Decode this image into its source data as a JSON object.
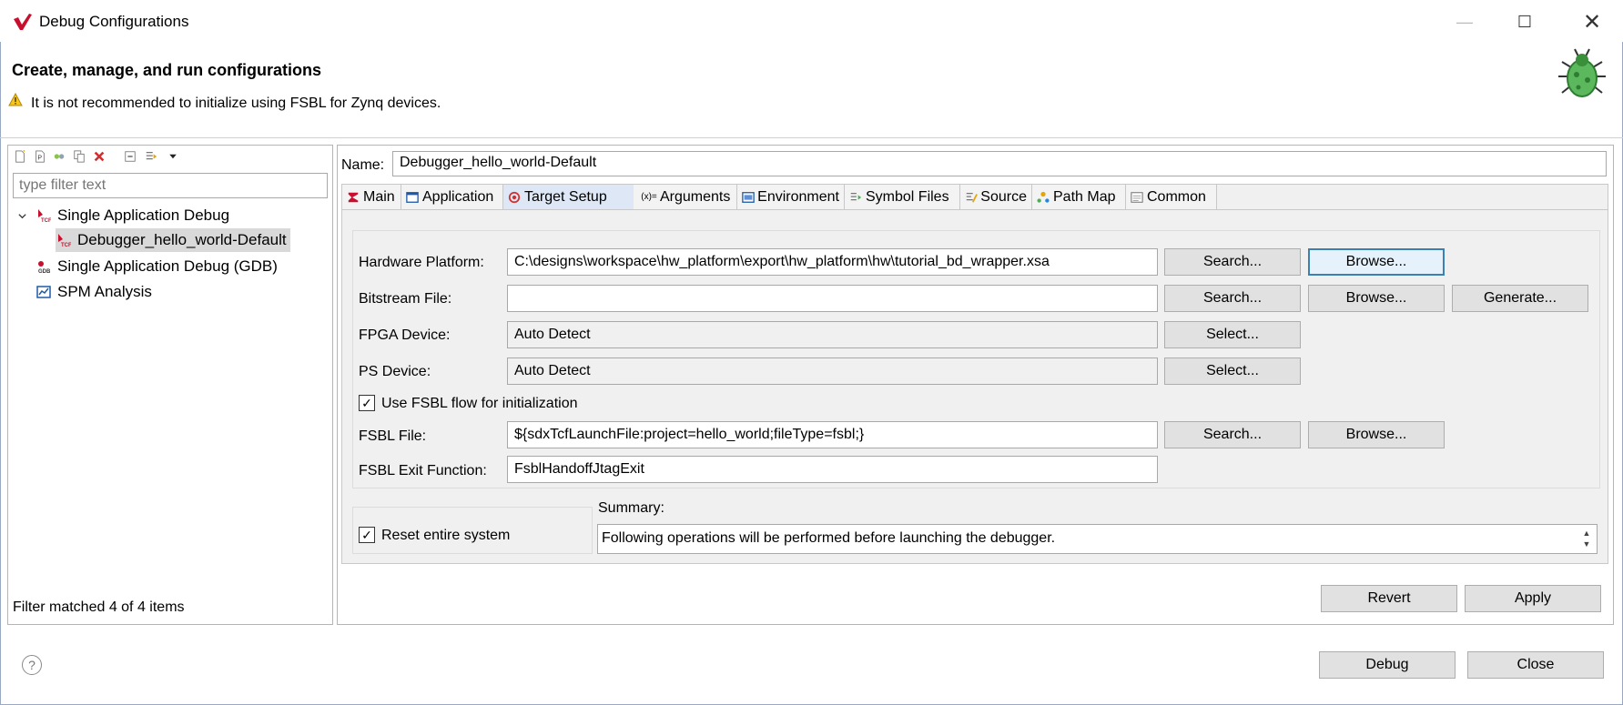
{
  "window": {
    "title": "Debug Configurations",
    "minimize": "—",
    "maximize": "☐",
    "close": "✕"
  },
  "header": {
    "title": "Create, manage, and run configurations",
    "message": "It is not recommended to initialize using FSBL for Zynq devices."
  },
  "left_panel": {
    "filter_placeholder": "type filter text",
    "toolbar_icons": [
      "new-config-icon",
      "new-prototype-icon",
      "export-icon",
      "duplicate-icon",
      "delete-icon",
      "collapse-all-icon",
      "filter-icon",
      "view-menu-icon"
    ],
    "tree": {
      "group1": "Single Application Debug",
      "child1": "Debugger_hello_world-Default",
      "group2": "Single Application Debug (GDB)",
      "group3": "SPM Analysis"
    },
    "status": "Filter matched 4 of 4 items"
  },
  "config": {
    "name_label": "Name:",
    "name_value": "Debugger_hello_world-Default",
    "tabs": {
      "main": "Main",
      "application": "Application",
      "target_setup": "Target Setup",
      "arguments": "Arguments",
      "environment": "Environment",
      "symbol_files": "Symbol Files",
      "source": "Source",
      "path_map": "Path Map",
      "common": "Common"
    },
    "active_tab": "Target Setup",
    "target_setup": {
      "hw_platform_label": "Hardware Platform:",
      "hw_platform_value": "C:\\designs\\workspace\\hw_platform\\export\\hw_platform\\hw\\tutorial_bd_wrapper.xsa",
      "bitstream_label": "Bitstream File:",
      "bitstream_value": "",
      "fpga_label": "FPGA Device:",
      "fpga_value": "Auto Detect",
      "ps_label": "PS Device:",
      "ps_value": "Auto Detect",
      "use_fsbl_label": "Use FSBL flow for initialization",
      "use_fsbl_checked": true,
      "fsbl_file_label": "FSBL File:",
      "fsbl_file_value": "${sdxTcfLaunchFile:project=hello_world;fileType=fsbl;}",
      "fsbl_exit_label": "FSBL Exit Function:",
      "fsbl_exit_value": "FsblHandoffJtagExit",
      "reset_label": "Reset entire system",
      "reset_checked": true,
      "summary_label": "Summary:",
      "summary_text": "Following operations will be performed before launching the debugger.",
      "search": "Search...",
      "browse": "Browse...",
      "generate": "Generate...",
      "select": "Select..."
    },
    "revert": "Revert",
    "apply": "Apply"
  },
  "footer": {
    "help": "?",
    "debug": "Debug",
    "close": "Close"
  },
  "colors": {
    "accent": "#3c7fb1",
    "tab_active_bg": "#dde7f5",
    "logo_red": "#c8102e",
    "bug_green": "#4caf50"
  }
}
